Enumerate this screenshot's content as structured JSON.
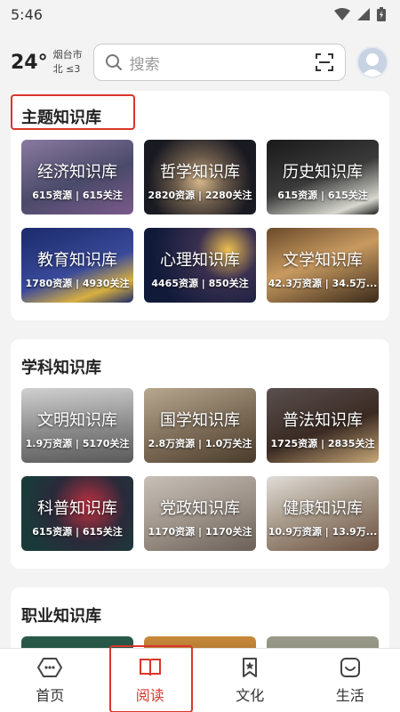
{
  "status": {
    "time": "5:46"
  },
  "header": {
    "temperature": "24°",
    "city": "烟台市",
    "wind": "北 ≤3",
    "search_placeholder": "搜索"
  },
  "sections": [
    {
      "title": "主题知识库",
      "cards": [
        {
          "name": "经济知识库",
          "stats": "615资源 | 615关注"
        },
        {
          "name": "哲学知识库",
          "stats": "2820资源 | 2280关注"
        },
        {
          "name": "历史知识库",
          "stats": "615资源 | 615关注"
        },
        {
          "name": "教育知识库",
          "stats": "1780资源 | 4930关注"
        },
        {
          "name": "心理知识库",
          "stats": "4465资源 | 850关注"
        },
        {
          "name": "文学知识库",
          "stats": "42.3万资源 | 34.5万..."
        }
      ]
    },
    {
      "title": "学科知识库",
      "cards": [
        {
          "name": "文明知识库",
          "stats": "1.9万资源 | 5170关注"
        },
        {
          "name": "国学知识库",
          "stats": "2.8万资源 | 1.0万关注"
        },
        {
          "name": "普法知识库",
          "stats": "1725资源 | 2835关注"
        },
        {
          "name": "科普知识库",
          "stats": "615资源 | 615关注"
        },
        {
          "name": "党政知识库",
          "stats": "1170资源 | 1170关注"
        },
        {
          "name": "健康知识库",
          "stats": "10.9万资源 | 13.9万..."
        }
      ]
    },
    {
      "title": "职业知识库",
      "cards": []
    }
  ],
  "nav": [
    {
      "label": "首页",
      "icon": "home-icon"
    },
    {
      "label": "阅读",
      "icon": "book-icon",
      "active": true
    },
    {
      "label": "文化",
      "icon": "star-icon"
    },
    {
      "label": "生活",
      "icon": "smile-icon"
    }
  ],
  "colors": {
    "accent": "#d9362b"
  }
}
